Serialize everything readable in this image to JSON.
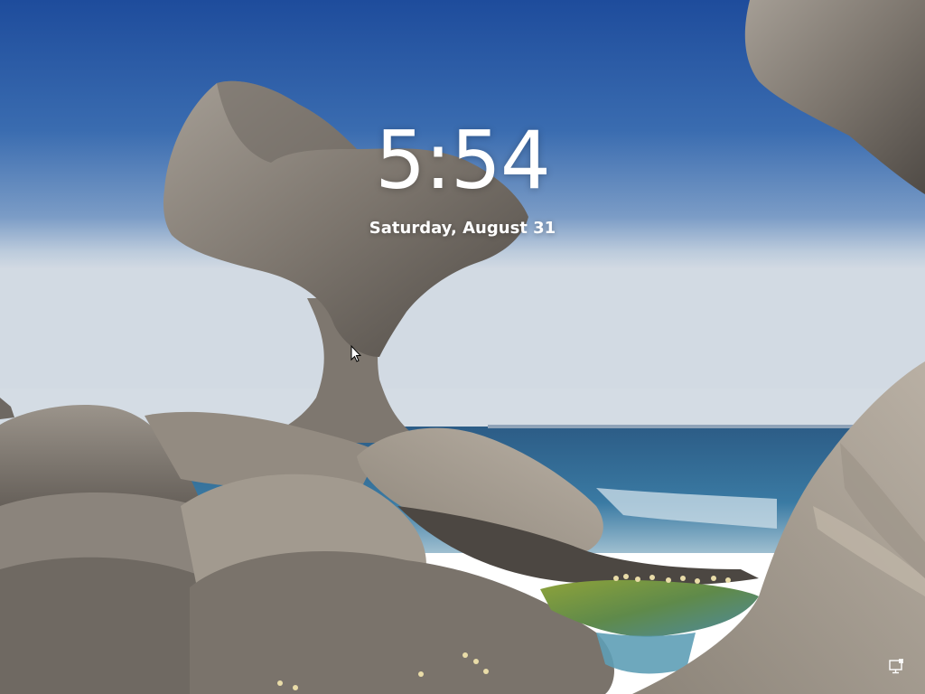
{
  "lock_screen": {
    "time": "5:54",
    "date": "Saturday, August 31"
  },
  "icons": {
    "network": "network-monitor-icon",
    "cursor": "mouse-pointer-icon"
  },
  "colors": {
    "sky_top": "#1f4fa0",
    "sky_horizon": "#c9d3df",
    "sea": "#2d6d97",
    "rock": "#8a847c",
    "text": "#ffffff"
  }
}
